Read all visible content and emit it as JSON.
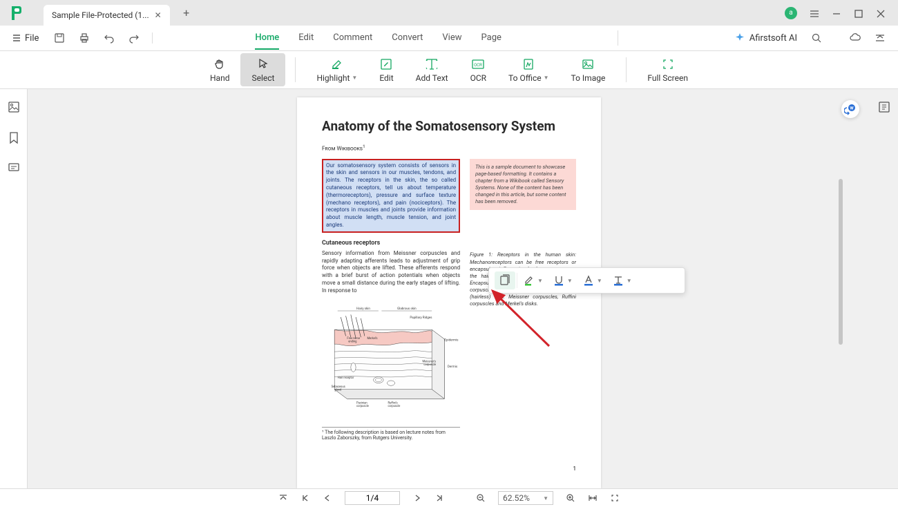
{
  "titlebar": {
    "tab_title": "Sample File-Protected (1...",
    "avatar_letter": "a"
  },
  "menubar": {
    "file": "File",
    "tabs": [
      "Home",
      "Edit",
      "Comment",
      "Convert",
      "View",
      "Page"
    ],
    "active_tab": "Home",
    "ai_label": "Afirstsoft AI"
  },
  "toolbar": {
    "hand": "Hand",
    "select": "Select",
    "highlight": "Highlight",
    "edit": "Edit",
    "add_text": "Add Text",
    "ocr": "OCR",
    "to_office": "To Office",
    "to_image": "To Image",
    "full_screen": "Full Screen"
  },
  "document": {
    "title": "Anatomy of the Somatosensory System",
    "source": "From Wikibooks",
    "highlighted_para": "Our somatosensory system consists of sensors in the skin and sensors in our muscles, tendons, and joints. The receptors in the skin, the so called cutaneous receptors, tell us about temperature (thermoreceptors), pressure and surface texture (mechano receptors), and pain (nociceptors). The receptors in muscles and joints provide information about muscle length, muscle tension, and joint angles.",
    "side_note": "This is a sample document to showcase page-based formatting. It contains a chapter from a Wikibook called Sensory Systems. None of the content has been changed in this article, but some content has been removed.",
    "subheading": "Cutaneous receptors",
    "body": "Sensory information from Meissner corpuscles and rapidly adapting afferents leads to adjustment of grip force when objects are lifted. These afferents respond with a brief burst of action potentials when objects move a small distance during the early stages of lifting. In response to",
    "fig_caption": "Figure 1: Receptors in the human skin: Mechanoreceptors can be free receptors or encapsulated. Examples for free receptors are the hair receptors at the roots of hairs. Encapsulated receptors are the Pacinian corpuscles and the receptors in the glabrous (hairless) skin: Meissner corpuscles, Ruffini corpuscles and Merkel's disks.",
    "footnote": "¹ The following description is based on lecture notes from Laszlo Zaborszky, from Rutgers University.",
    "fig_labels": {
      "hairy": "Hairy skin",
      "glabrous": "Glabrous skin",
      "papillary": "Papillary Ridges",
      "epidermis": "Epidermis",
      "dermis": "Dermis",
      "free": "Free nerve ending",
      "merkel": "Merkel's disk",
      "meissner": "Meissner's corpuscle",
      "hair_rec": "Hair receptor",
      "sebaceous": "Sebaceous gland",
      "pacinian": "Pacinian corpuscle",
      "ruffini": "Ruffini's corpuscle"
    },
    "page_number": "1"
  },
  "statusbar": {
    "page": "1/4",
    "zoom": "62.52%"
  },
  "anno_colors": {
    "highlight": "#39c639",
    "underline": "#2a6fd6",
    "font": "#2a6fd6",
    "strike": "#2a6fd6"
  }
}
